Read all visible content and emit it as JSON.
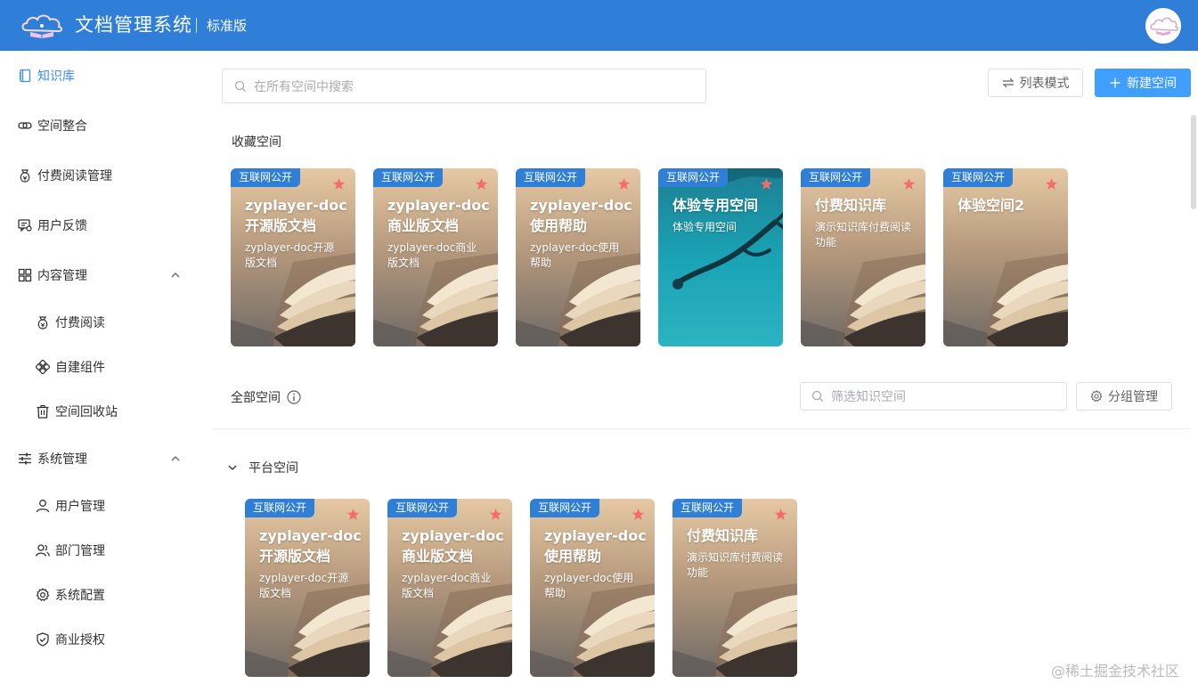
{
  "header": {
    "title": "文档管理系统",
    "edition": "标准版",
    "colors": {
      "bar": "#2f7fd8"
    }
  },
  "sidebar": {
    "items": [
      {
        "label": "知识库",
        "icon": "book-icon",
        "active": true
      },
      {
        "label": "空间整合",
        "icon": "link-icon"
      },
      {
        "label": "付费阅读管理",
        "icon": "money-bag-icon"
      },
      {
        "label": "用户反馈",
        "icon": "feedback-icon"
      },
      {
        "label": "内容管理",
        "icon": "grid-icon",
        "expanded": true
      },
      {
        "label": "付费阅读",
        "icon": "money-bag-icon"
      },
      {
        "label": "自建组件",
        "icon": "component-icon"
      },
      {
        "label": "空间回收站",
        "icon": "trash-icon"
      },
      {
        "label": "系统管理",
        "icon": "sliders-icon",
        "expanded": true
      },
      {
        "label": "用户管理",
        "icon": "user-icon"
      },
      {
        "label": "部门管理",
        "icon": "users-icon"
      },
      {
        "label": "系统配置",
        "icon": "gear-icon"
      },
      {
        "label": "商业授权",
        "icon": "shield-icon"
      }
    ]
  },
  "main": {
    "search_placeholder": "在所有空间中搜索",
    "list_mode_label": "列表模式",
    "new_space_label": "新建空间",
    "favorites_title": "收藏空间",
    "all_title": "全部空间",
    "filter_placeholder": "筛选知识空间",
    "group_manage_label": "分组管理",
    "group_name": "平台空间",
    "favorites": [
      {
        "badge": "互联网公开",
        "title": "zyplayer-doc开源版文档",
        "desc": "zyplayer-doc开源版文档",
        "bg": "book"
      },
      {
        "badge": "互联网公开",
        "title": "zyplayer-doc商业版文档",
        "desc": "zyplayer-doc商业版文档",
        "bg": "book"
      },
      {
        "badge": "互联网公开",
        "title": "zyplayer-doc使用帮助",
        "desc": "zyplayer-doc使用帮助",
        "bg": "book"
      },
      {
        "badge": "互联网公开",
        "title": "体验专用空间",
        "desc": "体验专用空间",
        "bg": "ocean"
      },
      {
        "badge": "互联网公开",
        "title": "付费知识库",
        "desc": "演示知识库付费阅读功能",
        "bg": "book"
      },
      {
        "badge": "互联网公开",
        "title": "体验空间2",
        "desc": "",
        "bg": "book"
      }
    ],
    "platform": [
      {
        "badge": "互联网公开",
        "title": "zyplayer-doc开源版文档",
        "desc": "zyplayer-doc开源版文档",
        "bg": "book"
      },
      {
        "badge": "互联网公开",
        "title": "zyplayer-doc商业版文档",
        "desc": "zyplayer-doc商业版文档",
        "bg": "book"
      },
      {
        "badge": "互联网公开",
        "title": "zyplayer-doc使用帮助",
        "desc": "zyplayer-doc使用帮助",
        "bg": "book"
      },
      {
        "badge": "互联网公开",
        "title": "付费知识库",
        "desc": "演示知识库付费阅读功能",
        "bg": "book"
      }
    ],
    "colors": {
      "primary": "#409eff",
      "star": "#f56c6c",
      "badge": "#2f7fd8"
    }
  },
  "watermark": "@稀土掘金技术社区"
}
